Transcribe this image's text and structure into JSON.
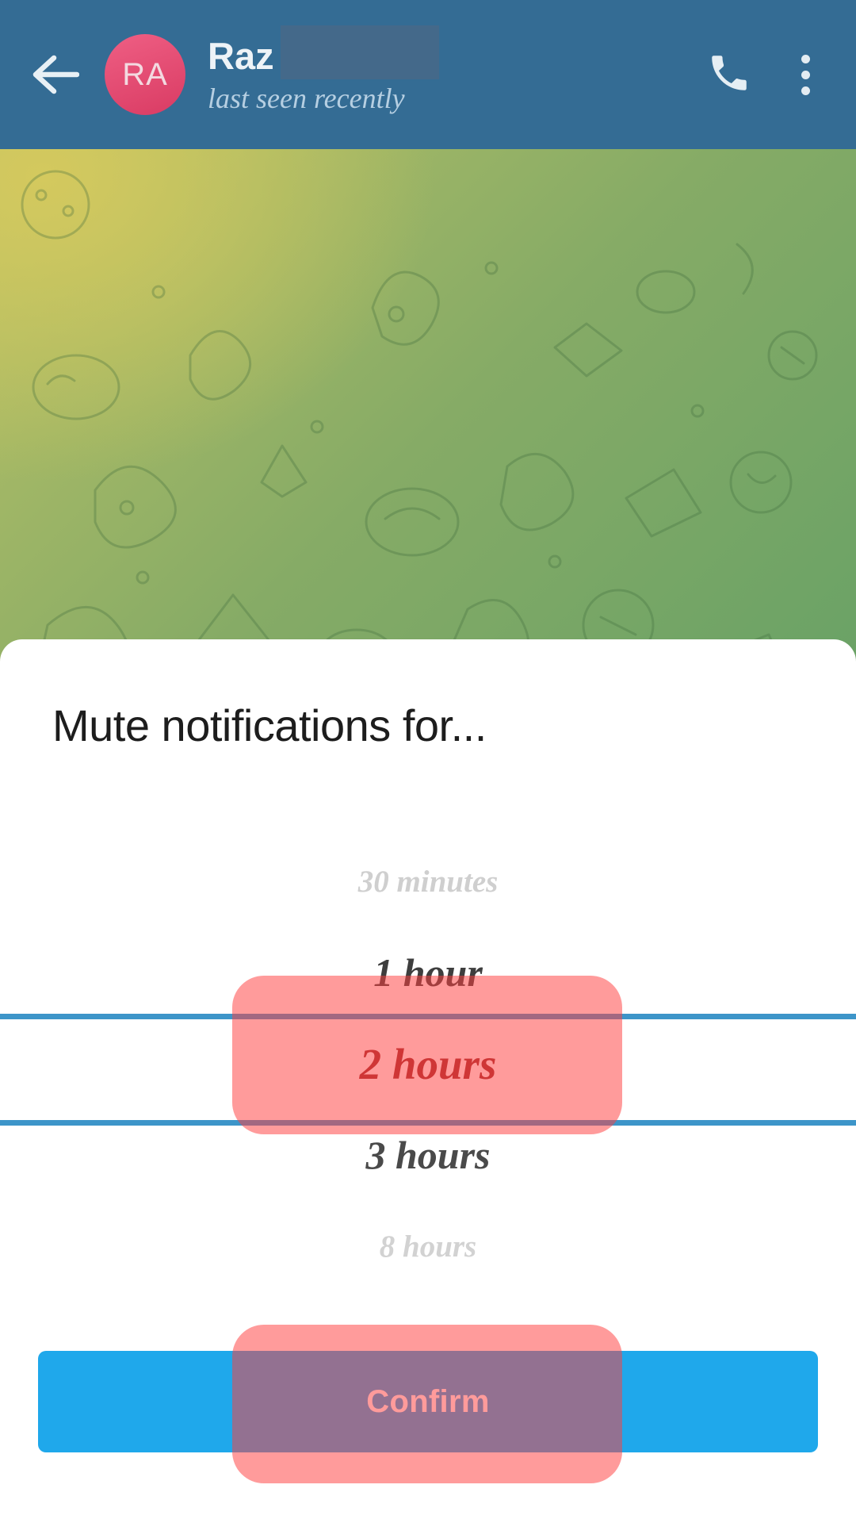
{
  "header": {
    "back_icon": "arrow-left-icon",
    "avatar_initials": "RA",
    "avatar_color": "#d93b63",
    "chat_title": "Raz",
    "chat_status": "last seen recently",
    "call_icon": "phone-icon",
    "menu_icon": "overflow-menu-icon",
    "background_color": "#346c94"
  },
  "dialog": {
    "title": "Mute notifications for...",
    "options": [
      {
        "label": "30 minutes",
        "state": "far"
      },
      {
        "label": "1 hour",
        "state": "near"
      },
      {
        "label": "2 hours",
        "state": "selected"
      },
      {
        "label": "3 hours",
        "state": "near"
      },
      {
        "label": "8 hours",
        "state": "far"
      }
    ],
    "selected_value": "2 hours",
    "confirm_label": "Confirm",
    "confirm_color": "#1fa8eb",
    "separator_color": "#3d95c9",
    "highlight_color": "#ff4040"
  }
}
